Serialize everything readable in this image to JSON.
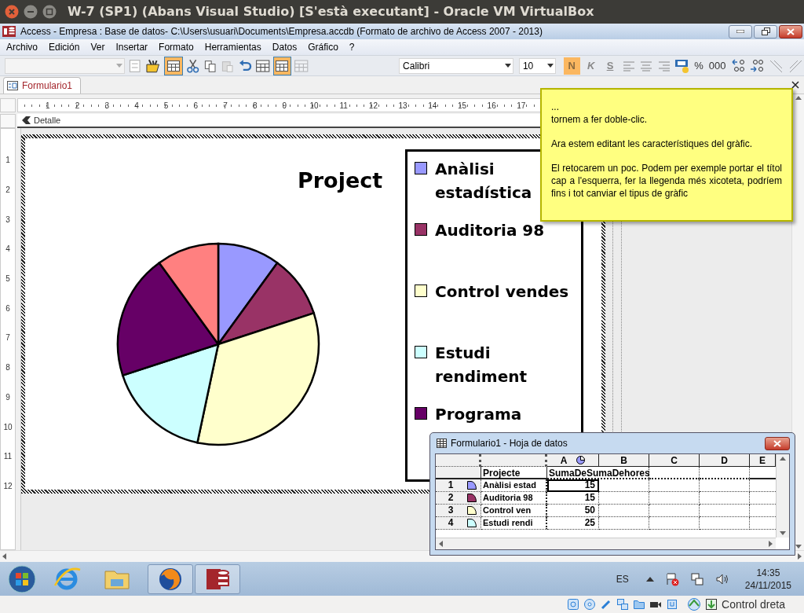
{
  "vm_window": {
    "title": "W-7 (SP1) (Abans Visual Studio) [S'està executant] - Oracle VM VirtualBox"
  },
  "access_window": {
    "title": "Access - Empresa : Base de datos- C:\\Users\\usuari\\Documents\\Empresa.accdb (Formato de archivo de Access 2007 - 2013)"
  },
  "menu": [
    "Archivo",
    "Edición",
    "Ver",
    "Insertar",
    "Formato",
    "Herramientas",
    "Datos",
    "Gráfico",
    "?"
  ],
  "toolbar": {
    "datasheet_view_on": true,
    "grid_view_on": true,
    "font": "Calibri",
    "size": "10",
    "format_buttons": [
      {
        "label": "N",
        "on": true
      },
      {
        "label": "K",
        "on": false
      },
      {
        "label": "S",
        "on": false
      }
    ],
    "number_buttons": [
      "%",
      "000"
    ]
  },
  "tabs": [
    {
      "label": "Formulario1",
      "selected": true
    }
  ],
  "ruler": {
    "horizontal": [
      "1",
      "2",
      "3",
      "4",
      "5",
      "6",
      "7",
      "8",
      "9",
      "10",
      "11",
      "12",
      "13",
      "14",
      "15",
      "16",
      "17"
    ],
    "vertical": [
      "1",
      "2",
      "3",
      "4",
      "5",
      "6",
      "7",
      "8",
      "9",
      "10",
      "11",
      "12"
    ]
  },
  "section": {
    "label": "Detalle"
  },
  "chart": {
    "title": "Project",
    "legend": [
      {
        "label": "Anàlisi estadística",
        "color": "#9999ff"
      },
      {
        "label": "Auditoria 98",
        "color": "#993366"
      },
      {
        "label": "Control vendes",
        "color": "#ffffcc"
      },
      {
        "label": "Estudi rendiment",
        "color": "#ccffff"
      },
      {
        "label": "Programa",
        "color": "#660066"
      }
    ]
  },
  "note": {
    "paragraphs": [
      "...\ntornem a fer doble-clic.",
      "Ara estem editant les característiques del gràfic.",
      "El retocarem un poc. Podem per exemple portar el títol cap a l'esquerra, fer la llegenda més xicoteta, podríem fins i tot canviar el tipus de gràfic"
    ]
  },
  "datasheet": {
    "title": "Formulario1 - Hoja de datos",
    "columns": [
      "A",
      "B",
      "C",
      "D",
      "E"
    ],
    "field_names": [
      "Projecte",
      "SumaDeSumaDehores"
    ],
    "rows": [
      {
        "number": "1",
        "color": "#9999ff",
        "name": "Anàlisi estad",
        "value": "15",
        "selected": true
      },
      {
        "number": "2",
        "color": "#993366",
        "name": "Auditoria 98",
        "value": "15",
        "selected": false
      },
      {
        "number": "3",
        "color": "#ffffcc",
        "name": "Control ven",
        "value": "50",
        "selected": false
      },
      {
        "number": "4",
        "color": "#ccffff",
        "name": "Estudi rendi",
        "value": "25",
        "selected": false
      }
    ]
  },
  "taskbar": {
    "language": "ES",
    "time": "14:35",
    "date": "24/11/2015"
  },
  "vm_status": {
    "host_key": "Control dreta"
  }
}
